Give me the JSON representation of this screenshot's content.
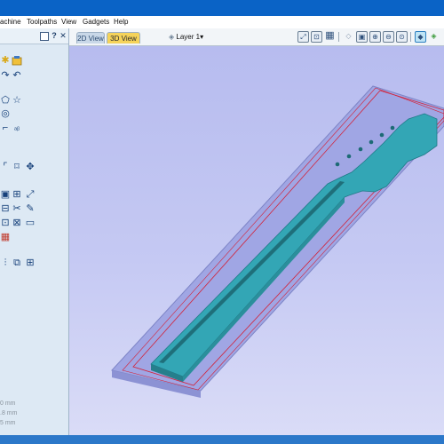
{
  "menu": {
    "items": [
      {
        "label": "achine"
      },
      {
        "label": "Toolpaths"
      },
      {
        "label": "View"
      },
      {
        "label": "Gadgets"
      },
      {
        "label": "Help"
      }
    ]
  },
  "view_tabs": {
    "tab_2d": "2D View",
    "tab_3d": "3D View",
    "active": "3D View"
  },
  "layer": {
    "label": "Layer 1",
    "dropdown_glyph": "▾"
  },
  "left_panel": {
    "coords": [
      "0 mm",
      ".8 mm",
      "5 mm"
    ]
  },
  "colors": {
    "titlebar": "#0a63c6",
    "panel": "#dde9f4",
    "viewport_top": "#b7bcef",
    "viewport_bottom": "#dadcf7",
    "neck": "#33a6b5",
    "neck_dark": "#267f8c",
    "stock": "#a0a6e4",
    "boundary": "#d2233a",
    "active_tab": "#f5d35a"
  },
  "icons": {
    "view_toolbar": [
      "zoom-all-icon",
      "zoom-box-icon",
      "grid-icon",
      "iso-view-icon",
      "top-view-icon",
      "zoom-in-icon",
      "zoom-out-icon",
      "zoom-selection-icon",
      "shaded-view-icon",
      "toolpath-preview-icon",
      "layer-visibility-icon"
    ]
  }
}
